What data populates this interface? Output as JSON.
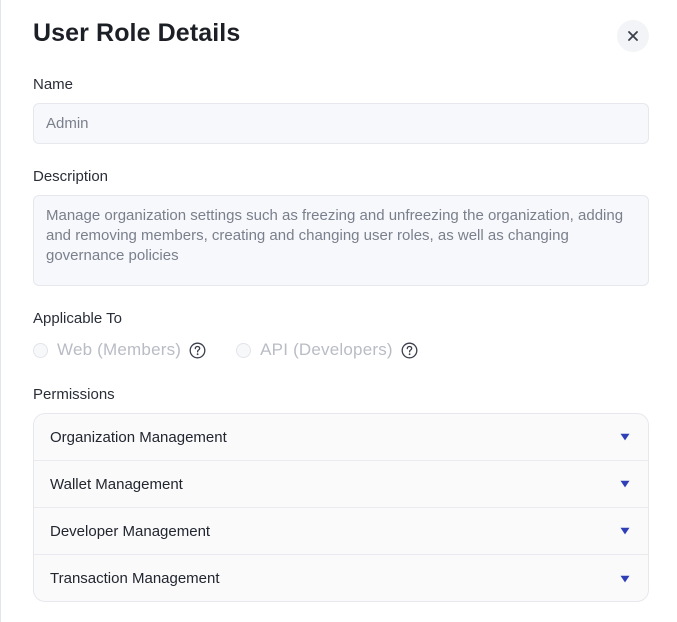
{
  "dialog": {
    "title": "User Role Details"
  },
  "name_field": {
    "label": "Name",
    "value": "Admin"
  },
  "description_field": {
    "label": "Description",
    "value": "Manage organization settings such as freezing and unfreezing the organization, adding and removing members, creating and changing user roles, as well as changing governance policies"
  },
  "applicable_to": {
    "label": "Applicable To",
    "options": [
      {
        "label": "Web (Members)",
        "selected": false,
        "help_icon": "question-circle-icon"
      },
      {
        "label": "API (Developers)",
        "selected": false,
        "help_icon": "question-circle-icon"
      }
    ]
  },
  "permissions": {
    "label": "Permissions",
    "items": [
      {
        "label": "Organization Management",
        "icon": "caret-down-icon"
      },
      {
        "label": "Wallet Management",
        "icon": "caret-down-icon"
      },
      {
        "label": "Developer Management",
        "icon": "caret-down-icon"
      },
      {
        "label": "Transaction Management",
        "icon": "caret-down-icon"
      }
    ]
  },
  "colors": {
    "caret_accent": "#2f3fb5",
    "field_background": "#f7f8fb",
    "disabled_text": "#b9bcc5"
  }
}
